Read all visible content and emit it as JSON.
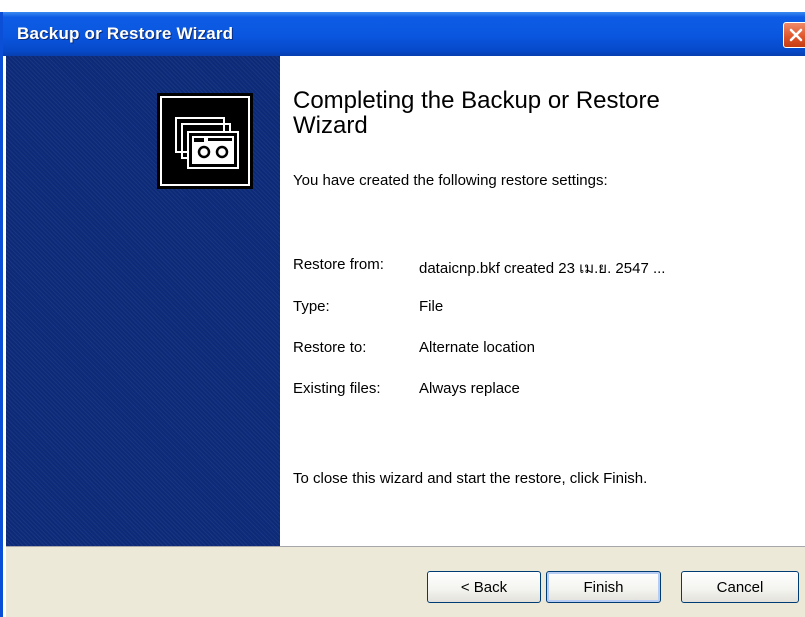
{
  "window": {
    "title": "Backup or Restore Wizard",
    "accent_color": "#0a56df",
    "side_panel_color": "#0c2a78"
  },
  "titlebar": {
    "close_icon": "close-icon"
  },
  "side_panel": {
    "icon": "backup-tape-icon"
  },
  "content": {
    "heading": "Completing the Backup or Restore Wizard",
    "intro": "You have created the following restore settings:",
    "settings": [
      {
        "label": "Restore from:",
        "value": "dataicnp.bkf created 23 เม.ย. 2547 ..."
      },
      {
        "label": "Type:",
        "value": "File"
      },
      {
        "label": "Restore to:",
        "value": "Alternate location"
      },
      {
        "label": "Existing files:",
        "value": "Always replace"
      }
    ],
    "closing": "To close this wizard and start the restore, click Finish."
  },
  "buttons": {
    "back": "< Back",
    "finish": "Finish",
    "cancel": "Cancel"
  }
}
